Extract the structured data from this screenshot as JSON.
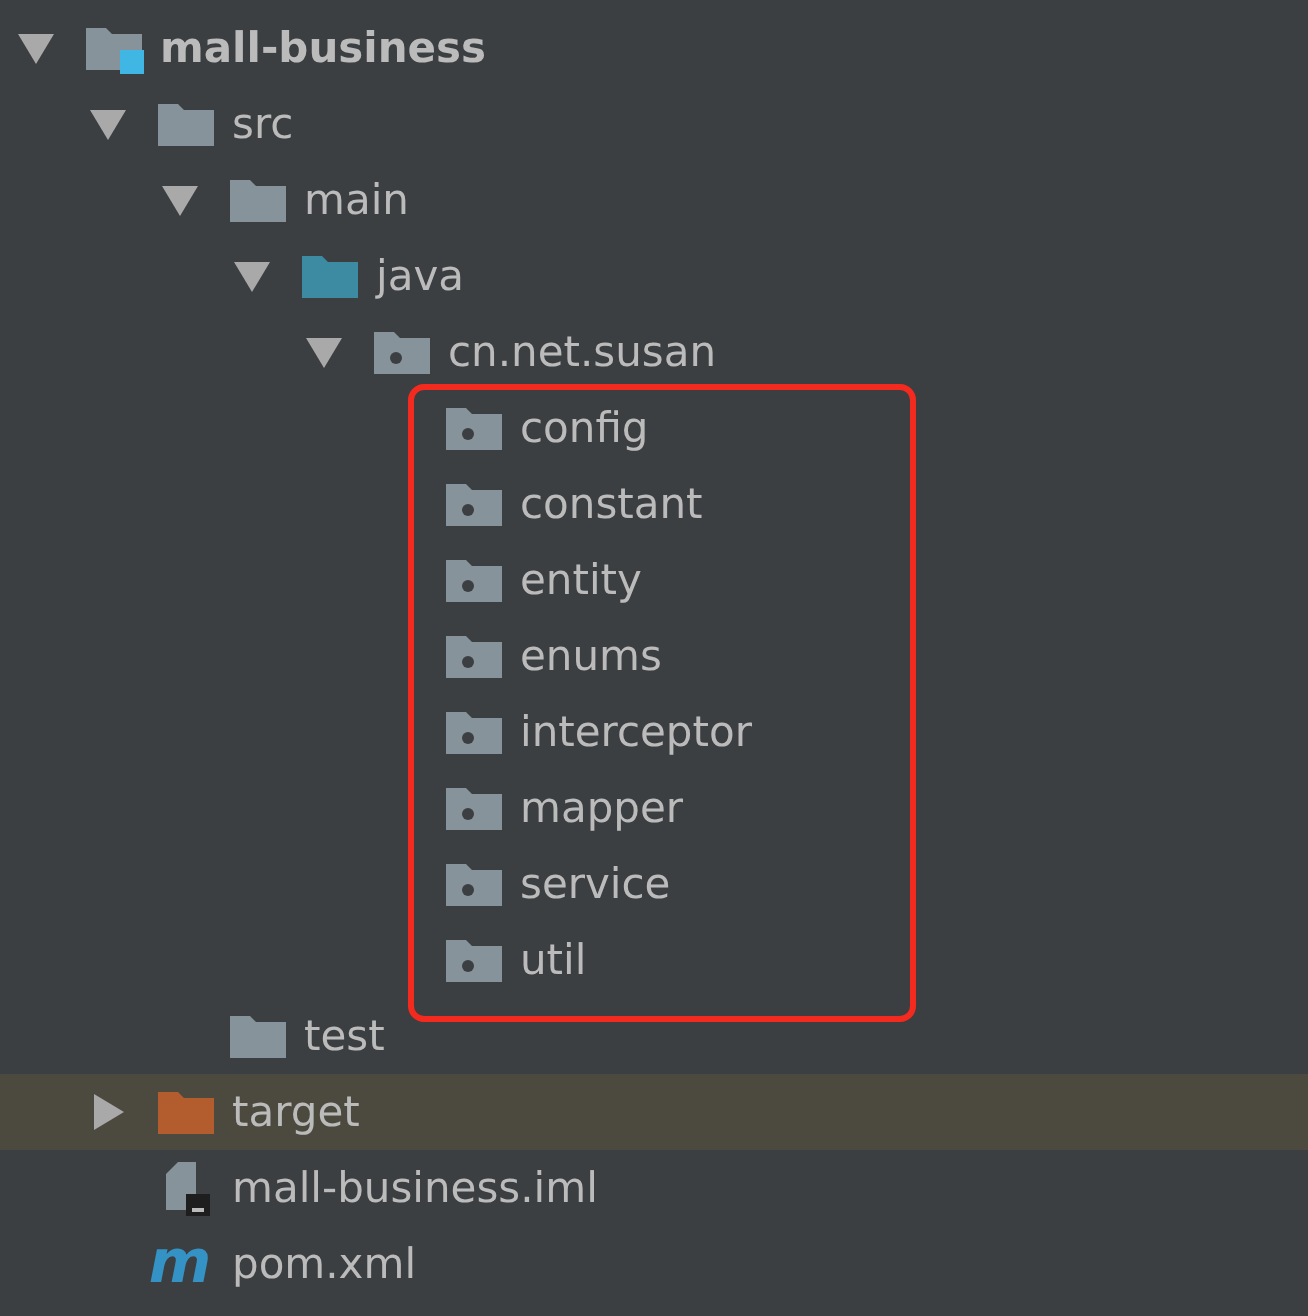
{
  "tree": [
    {
      "label": "mall-business",
      "kind": "module",
      "expanded": true,
      "selected": false,
      "children": [
        {
          "label": "src",
          "kind": "folder",
          "expanded": true,
          "selected": false,
          "children": [
            {
              "label": "main",
              "kind": "folder",
              "expanded": true,
              "selected": false,
              "children": [
                {
                  "label": "java",
                  "kind": "source-folder",
                  "expanded": true,
                  "selected": false,
                  "children": [
                    {
                      "label": "cn.net.susan",
                      "kind": "package",
                      "expanded": true,
                      "selected": false,
                      "highlight_children": true,
                      "children": [
                        {
                          "label": "config",
                          "kind": "package",
                          "selected": false
                        },
                        {
                          "label": "constant",
                          "kind": "package",
                          "selected": false
                        },
                        {
                          "label": "entity",
                          "kind": "package",
                          "selected": false
                        },
                        {
                          "label": "enums",
                          "kind": "package",
                          "selected": false
                        },
                        {
                          "label": "interceptor",
                          "kind": "package",
                          "selected": false
                        },
                        {
                          "label": "mapper",
                          "kind": "package",
                          "selected": false
                        },
                        {
                          "label": "service",
                          "kind": "package",
                          "selected": false
                        },
                        {
                          "label": "util",
                          "kind": "package",
                          "selected": false
                        }
                      ]
                    }
                  ]
                }
              ]
            },
            {
              "label": "test",
              "kind": "folder",
              "selected": false
            }
          ]
        },
        {
          "label": "target",
          "kind": "excluded-folder",
          "expanded": false,
          "selected": true
        },
        {
          "label": "mall-business.iml",
          "kind": "iml-file",
          "selected": false
        },
        {
          "label": "pom.xml",
          "kind": "maven-file",
          "icon_text": "m",
          "selected": false
        }
      ]
    }
  ]
}
